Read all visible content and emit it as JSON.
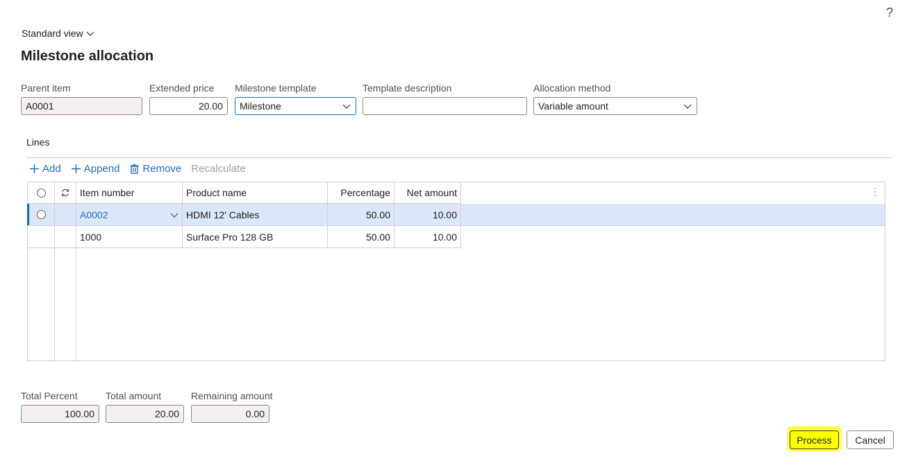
{
  "help_label": "?",
  "view_selector": {
    "label": "Standard view"
  },
  "page_title": "Milestone allocation",
  "header_fields": {
    "parent_item": {
      "label": "Parent item",
      "value": "A0001"
    },
    "extended_price": {
      "label": "Extended price",
      "value": "20.00"
    },
    "milestone_template": {
      "label": "Milestone template",
      "value": "Milestone"
    },
    "template_description": {
      "label": "Template description",
      "value": ""
    },
    "allocation_method": {
      "label": "Allocation method",
      "value": "Variable amount"
    }
  },
  "lines": {
    "title": "Lines",
    "toolbar": {
      "add": "Add",
      "append": "Append",
      "remove": "Remove",
      "recalculate": "Recalculate"
    },
    "columns": {
      "item_number": "Item number",
      "product_name": "Product name",
      "percentage": "Percentage",
      "net_amount": "Net amount"
    },
    "rows": [
      {
        "item_number": "A0002",
        "product_name": "HDMI 12' Cables",
        "percentage": "50.00",
        "net_amount": "10.00"
      },
      {
        "item_number": "1000",
        "product_name": "Surface Pro 128 GB",
        "percentage": "50.00",
        "net_amount": "10.00"
      }
    ]
  },
  "totals": {
    "total_percent": {
      "label": "Total Percent",
      "value": "100.00"
    },
    "total_amount": {
      "label": "Total amount",
      "value": "20.00"
    },
    "remaining_amount": {
      "label": "Remaining amount",
      "value": "0.00"
    }
  },
  "buttons": {
    "process": "Process",
    "cancel": "Cancel"
  },
  "colors": {
    "accent": "#0f6cbd",
    "link": "#1b6ac9",
    "selected_row": "#dbe6f8",
    "highlight": "#ffff00"
  }
}
